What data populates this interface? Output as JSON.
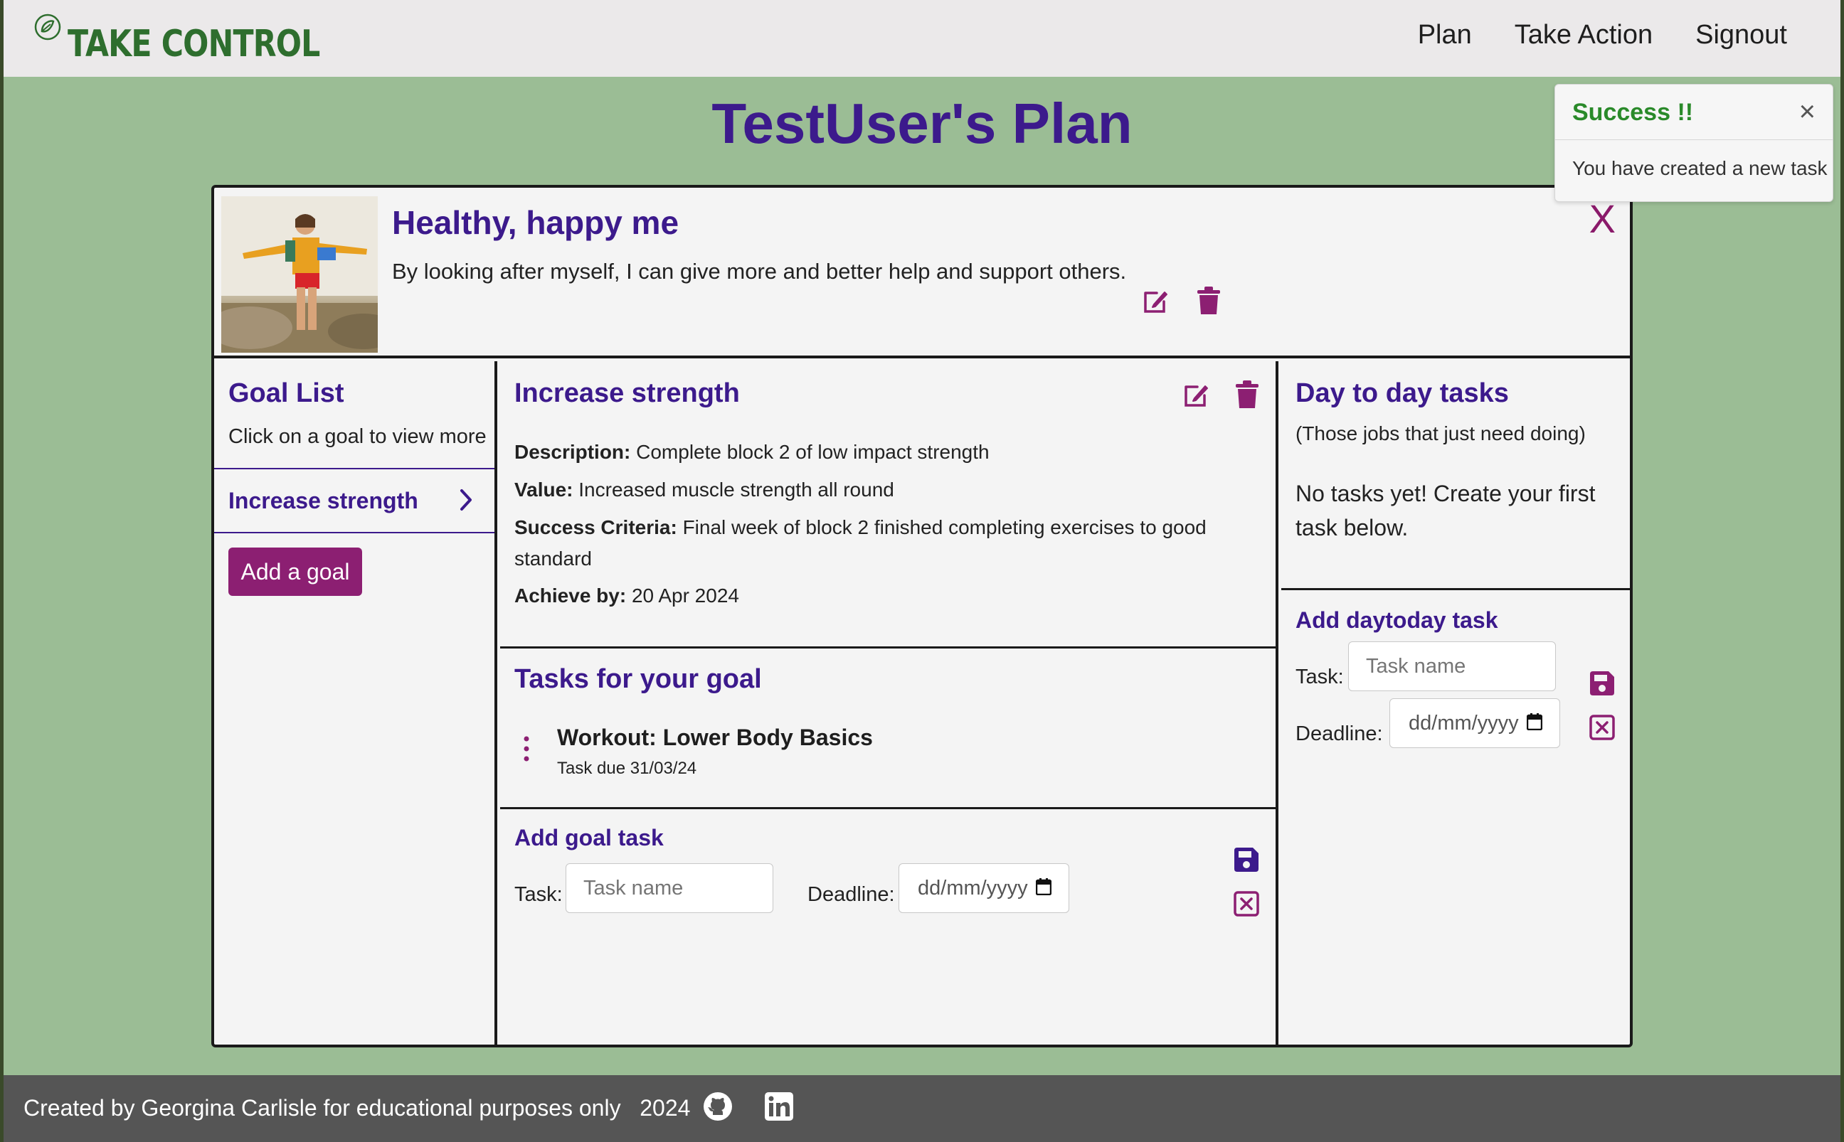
{
  "navbar": {
    "brand": "TAKE CONTROL",
    "links": [
      "Plan",
      "Take Action",
      "Signout"
    ]
  },
  "page": {
    "title": "TestUser's Plan"
  },
  "toast": {
    "title": "Success !!",
    "close": "×",
    "message": "You have created a new task"
  },
  "plan": {
    "title": "Healthy, happy me",
    "description": "By looking after myself, I can give more and better help and support others.",
    "close": "X"
  },
  "goal_list": {
    "title": "Goal List",
    "hint": "Click on a goal to view more",
    "items": [
      {
        "label": "Increase strength"
      }
    ],
    "add_button": "Add a goal"
  },
  "goal": {
    "title": "Increase strength",
    "description_label": "Description:",
    "description": "Complete block 2 of low impact strength",
    "value_label": "Value:",
    "value": "Increased muscle strength all round",
    "success_label": "Success Criteria:",
    "success": "Final week of block 2 finished completing exercises to good standard",
    "achieve_label": "Achieve by:",
    "achieve": "20 Apr 2024"
  },
  "goal_tasks": {
    "title": "Tasks for your goal",
    "items": [
      {
        "name": "Workout: Lower Body Basics",
        "due": "Task due 31/03/24"
      }
    ]
  },
  "add_goal_task": {
    "title": "Add goal task",
    "task_label": "Task:",
    "task_placeholder": "Task name",
    "deadline_label": "Deadline:",
    "deadline_value": "dd/mm/yyyy"
  },
  "day_to_day": {
    "title": "Day to day tasks",
    "subtitle": "(Those jobs that just need doing)",
    "empty": "No tasks yet! Create your first task below.",
    "add_title": "Add daytoday task",
    "task_label": "Task:",
    "task_placeholder": "Task name",
    "deadline_label": "Deadline:",
    "deadline_value": "dd/mm/yyyy"
  },
  "footer": {
    "text": "Created by Georgina Carlisle for educational purposes only   2024"
  },
  "colors": {
    "background": "#9bbd95",
    "brand_green": "#2e6e2e",
    "heading_purple": "#3c1a8c",
    "accent_magenta": "#8c1f72",
    "footer": "#555555"
  },
  "icons": {
    "brand": "leaf-logo-icon",
    "edit": "edit-icon",
    "delete": "trash-icon",
    "save": "save-icon",
    "cancel": "cancel-icon",
    "chevron": "chevron-right-icon",
    "menu": "vertical-dots-icon",
    "calendar": "calendar-icon",
    "github": "github-icon",
    "linkedin": "linkedin-icon"
  }
}
